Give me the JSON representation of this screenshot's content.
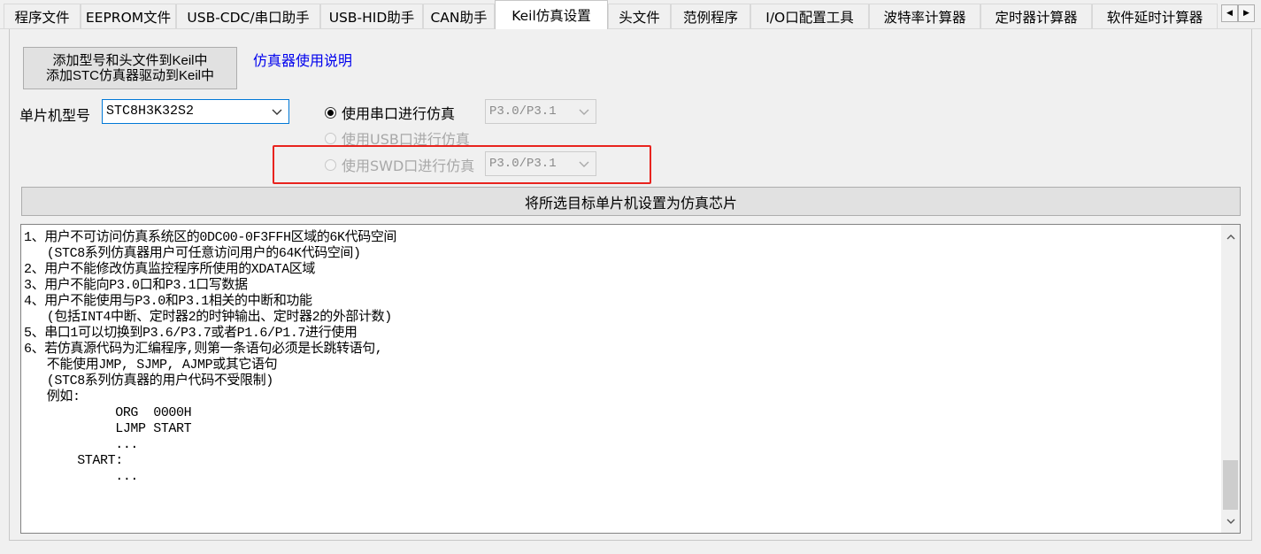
{
  "tabs": [
    {
      "label": "程序文件",
      "active": false
    },
    {
      "label": "EEPROM文件",
      "active": false
    },
    {
      "label": "USB-CDC/串口助手",
      "active": false
    },
    {
      "label": "USB-HID助手",
      "active": false
    },
    {
      "label": "CAN助手",
      "active": false
    },
    {
      "label": "Keil仿真设置",
      "active": true
    },
    {
      "label": "头文件",
      "active": false
    },
    {
      "label": "范例程序",
      "active": false
    },
    {
      "label": "I/O口配置工具",
      "active": false
    },
    {
      "label": "波特率计算器",
      "active": false
    },
    {
      "label": "定时器计算器",
      "active": false
    },
    {
      "label": "软件延时计算器",
      "active": false
    }
  ],
  "tab_scroll": {
    "left": "◀",
    "right": "▶"
  },
  "add_button": {
    "line1": "添加型号和头文件到Keil中",
    "line2": "添加STC仿真器驱动到Keil中"
  },
  "help_link": "仿真器使用说明",
  "model": {
    "label": "单片机型号",
    "value": "STC8H3K32S2"
  },
  "radios": [
    {
      "label": "使用串口进行仿真",
      "checked": true,
      "enabled": true,
      "port": "P3.0/P3.1"
    },
    {
      "label": "使用USB口进行仿真",
      "checked": false,
      "enabled": false
    },
    {
      "label": "使用SWD口进行仿真",
      "checked": false,
      "enabled": false,
      "port": "P3.0/P3.1"
    }
  ],
  "set_button": "将所选目标单片机设置为仿真芯片",
  "notes": [
    "1、用户不可访问仿真系统区的0DC00-0F3FFH区域的6K代码空间",
    "   (STC8系列仿真器用户可任意访问用户的64K代码空间)",
    "2、用户不能修改仿真监控程序所使用的XDATA区域",
    "3、用户不能向P3.0口和P3.1口写数据",
    "4、用户不能使用与P3.0和P3.1相关的中断和功能",
    "   (包括INT4中断、定时器2的时钟输出、定时器2的外部计数)",
    "5、串口1可以切换到P3.6/P3.7或者P1.6/P1.7进行使用",
    "6、若仿真源代码为汇编程序,则第一条语句必须是长跳转语句,",
    "   不能使用JMP, SJMP, AJMP或其它语句",
    "   (STC8系列仿真器的用户代码不受限制)",
    "   例如:",
    "            ORG  0000H",
    "            LJMP START",
    "            ...",
    "       START:",
    "            ..."
  ],
  "colors": {
    "link": "#0000ee",
    "highlight": "#e8231e",
    "focus_border": "#0078d7"
  },
  "icons": {
    "dropdown": "chevron-down-icon",
    "scroll_up": "chevron-up-icon",
    "scroll_down": "chevron-down-icon"
  }
}
